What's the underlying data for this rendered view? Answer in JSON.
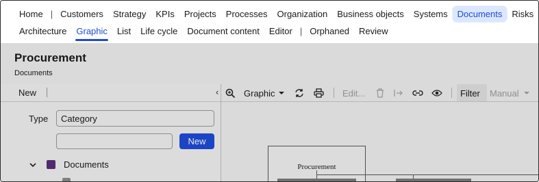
{
  "nav": {
    "row1": [
      {
        "label": "Home",
        "name": "nav-home"
      },
      {
        "sep": true
      },
      {
        "label": "Customers",
        "name": "nav-customers"
      },
      {
        "label": "Strategy",
        "name": "nav-strategy"
      },
      {
        "label": "KPIs",
        "name": "nav-kpis"
      },
      {
        "label": "Projects",
        "name": "nav-projects"
      },
      {
        "label": "Processes",
        "name": "nav-processes"
      },
      {
        "label": "Organization",
        "name": "nav-organization"
      },
      {
        "label": "Business objects",
        "name": "nav-business-objects"
      },
      {
        "label": "Systems",
        "name": "nav-systems"
      },
      {
        "label": "Documents",
        "name": "nav-documents",
        "active": true
      },
      {
        "label": "Risks",
        "name": "nav-risks"
      }
    ],
    "row2": [
      {
        "label": "Architecture",
        "name": "tab-architecture"
      },
      {
        "label": "Graphic",
        "name": "tab-graphic",
        "active": true
      },
      {
        "label": "List",
        "name": "tab-list"
      },
      {
        "label": "Life cycle",
        "name": "tab-life-cycle"
      },
      {
        "label": "Document content",
        "name": "tab-document-content"
      },
      {
        "label": "Editor",
        "name": "tab-editor"
      },
      {
        "sep": true
      },
      {
        "label": "Orphaned",
        "name": "tab-orphaned"
      },
      {
        "label": "Review",
        "name": "tab-review"
      }
    ]
  },
  "header": {
    "title": "Procurement",
    "subtitle": "Documents"
  },
  "left": {
    "new_label": "New",
    "collapse_glyph": "‹",
    "type_label": "Type",
    "type_value": "Category",
    "search_value": "",
    "new_button": "New",
    "tree": {
      "label": "Documents",
      "color": "#5b2d7a"
    }
  },
  "right": {
    "view_label": "Graphic",
    "edit_label": "Edit...",
    "filter_label": "Filter",
    "manual_label": "Manual",
    "icons": [
      "zoom-in-icon",
      "refresh-icon",
      "print-icon",
      "delete-icon",
      "move-icon",
      "link-icon",
      "eye-icon"
    ]
  },
  "diagram": {
    "root": "Procurement"
  },
  "colors": {
    "accent": "#1e4bd6",
    "active_bg": "#dbe7ff",
    "tree_swatch": "#5b2d7a"
  }
}
